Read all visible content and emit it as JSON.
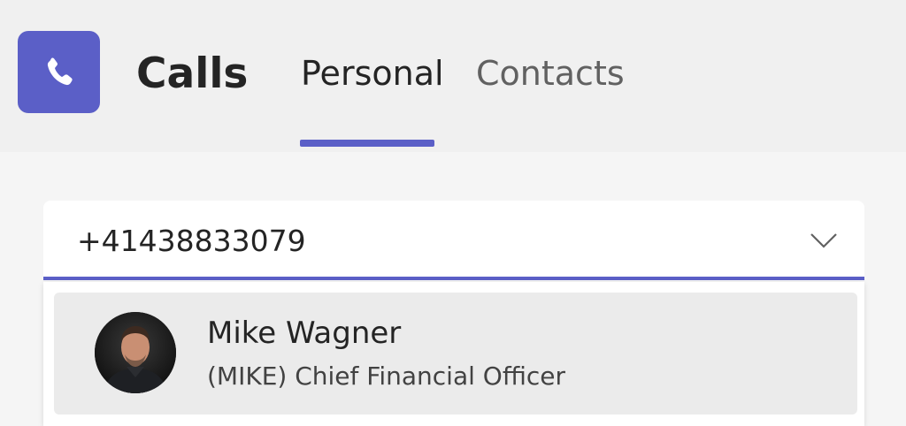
{
  "app": {
    "title": "Calls",
    "icon": "phone-icon",
    "accent_color": "#5b5fc7"
  },
  "tabs": [
    {
      "label": "Personal",
      "selected": true
    },
    {
      "label": "Contacts",
      "selected": false
    }
  ],
  "dial": {
    "value": "+41438833079",
    "dropdown_icon": "chevron-down-icon"
  },
  "results": [
    {
      "name": "Mike Wagner",
      "title": "(MIKE) Chief Financial Officer",
      "avatar": "avatar-photo"
    }
  ]
}
